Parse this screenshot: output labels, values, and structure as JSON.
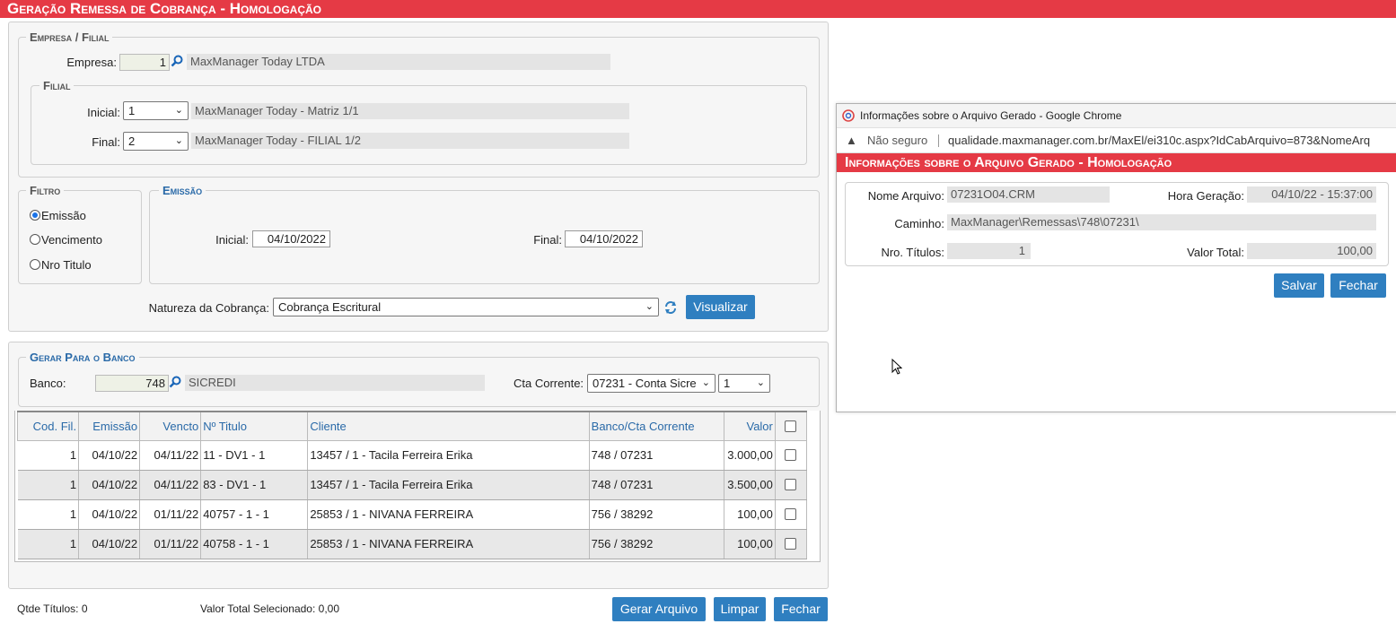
{
  "header": {
    "title": "Geração Remessa de Cobrança  - Homologação"
  },
  "empresa_filial": {
    "legend": "Empresa / Filial",
    "empresa_label": "Empresa:",
    "empresa_code": "1",
    "empresa_name": "MaxManager Today LTDA",
    "filial_legend": "Filial",
    "inicial_label": "Inicial:",
    "inicial_value": "1",
    "inicial_name": "MaxManager Today - Matriz 1/1",
    "final_label": "Final:",
    "final_value": "2",
    "final_name": "MaxManager Today - FILIAL 1/2"
  },
  "filtro": {
    "legend": "Filtro",
    "options": [
      "Emissão",
      "Vencimento",
      "Nro Titulo"
    ],
    "selected": "Emissão"
  },
  "emissao": {
    "legend": "Emissão",
    "inicial_label": "Inicial:",
    "inicial_value": "04/10/2022",
    "final_label": "Final:",
    "final_value": "04/10/2022"
  },
  "natureza": {
    "label": "Natureza da Cobrança:",
    "value": "Cobrança Escritural",
    "visualizar_label": "Visualizar"
  },
  "banco": {
    "legend": "Gerar Para o Banco",
    "label": "Banco:",
    "code": "748",
    "name": "SICREDI",
    "cta_label": "Cta Corrente:",
    "cta_value": "07231 - Conta Sicre",
    "cta_seq": "1"
  },
  "table": {
    "columns": [
      "Cod. Fil.",
      "Emissão",
      "Vencto",
      "Nº Titulo",
      "Cliente",
      "Banco/Cta Corrente",
      "Valor"
    ],
    "rows": [
      {
        "fil": "1",
        "emissao": "04/10/22",
        "vencto": "04/11/22",
        "titulo": "11 - DV1 - 1",
        "cliente": "13457 / 1 - Tacila Ferreira Erika",
        "banco": "748 / 07231",
        "valor": "3.000,00"
      },
      {
        "fil": "1",
        "emissao": "04/10/22",
        "vencto": "04/11/22",
        "titulo": "83 - DV1 - 1",
        "cliente": "13457 / 1 - Tacila Ferreira Erika",
        "banco": "748 / 07231",
        "valor": "3.500,00"
      },
      {
        "fil": "1",
        "emissao": "04/10/22",
        "vencto": "01/11/22",
        "titulo": "40757 - 1 - 1",
        "cliente": "25853 / 1 - NIVANA FERREIRA",
        "banco": "756 / 38292",
        "valor": "100,00"
      },
      {
        "fil": "1",
        "emissao": "04/10/22",
        "vencto": "01/11/22",
        "titulo": "40758 - 1 - 1",
        "cliente": "25853 / 1 - NIVANA FERREIRA",
        "banco": "756 / 38292",
        "valor": "100,00"
      }
    ]
  },
  "footer": {
    "qtde": "Qtde Títulos: 0",
    "valor_total": "Valor Total Selecionado: 0,00",
    "gerar_label": "Gerar Arquivo",
    "limpar_label": "Limpar",
    "fechar_label": "Fechar"
  },
  "popup": {
    "window_title": "Informações sobre o Arquivo Gerado - Google Chrome",
    "security": "Não seguro",
    "url": "qualidade.maxmanager.com.br/MaxEl/ei310c.aspx?IdCabArquivo=873&NomeArq",
    "header": "Informações sobre o Arquivo Gerado  - Homologação",
    "nome_label": "Nome Arquivo:",
    "nome_value": "07231O04.CRM",
    "hora_label": "Hora Geração:",
    "hora_value": "04/10/22 - 15:37:00",
    "caminho_label": "Caminho:",
    "caminho_value": "MaxManager\\Remessas\\748\\07231\\",
    "nro_label": "Nro. Títulos:",
    "nro_value": "1",
    "valor_label": "Valor Total:",
    "valor_value": "100,00",
    "salvar_label": "Salvar",
    "fechar_label": "Fechar"
  }
}
